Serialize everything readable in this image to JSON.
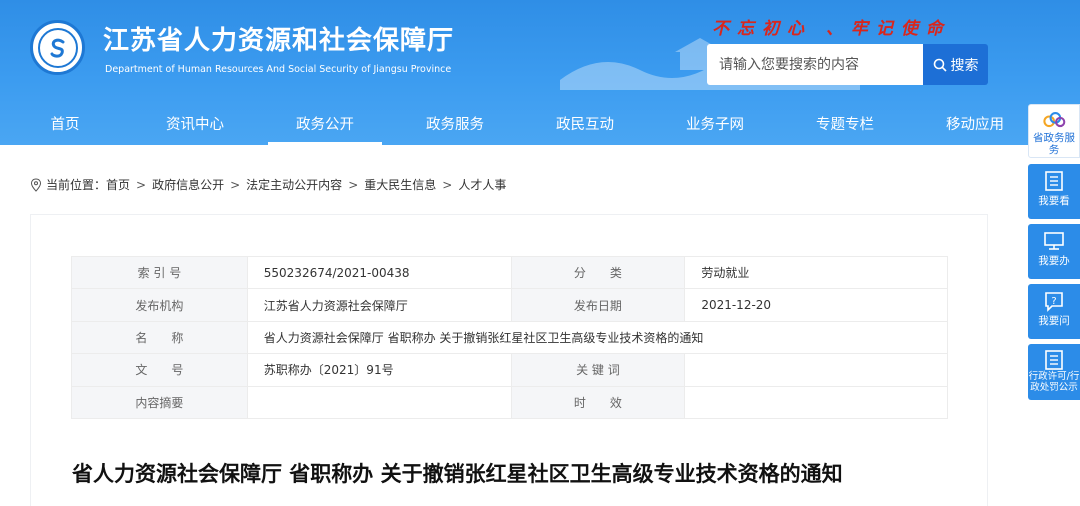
{
  "header": {
    "title": "江苏省人力资源和社会保障厅",
    "subtitle": "Department of Human Resources And Social Security of Jiangsu Province",
    "slogan": "不忘初心 、牢记使命",
    "search_placeholder": "请输入您要搜索的内容",
    "search_button": "搜索"
  },
  "nav": {
    "items": [
      "首页",
      "资讯中心",
      "政务公开",
      "政务服务",
      "政民互动",
      "业务子网",
      "专题专栏",
      "移动应用"
    ],
    "active": "政务公开"
  },
  "breadcrumb": {
    "prefix": "当前位置：",
    "items": [
      "首页",
      "政府信息公开",
      "法定主动公开内容",
      "重大民生信息",
      "人才人事"
    ]
  },
  "meta": {
    "rows": [
      {
        "l1": "索 引 号",
        "v1": "550232674/2021-00438",
        "l2": "分　　类",
        "v2": "劳动就业"
      },
      {
        "l1": "发布机构",
        "v1": "江苏省人力资源社会保障厅",
        "l2": "发布日期",
        "v2": "2021-12-20"
      },
      {
        "l1": "名　　称",
        "v1": "省人力资源社会保障厅 省职称办 关于撤销张红星社区卫生高级专业技术资格的通知"
      },
      {
        "l1": "文　　号",
        "v1": "苏职称办〔2021〕91号",
        "l2": "关 键 词",
        "v2": ""
      },
      {
        "l1": "内容摘要",
        "v1": "",
        "l2": "时　　效",
        "v2": ""
      }
    ]
  },
  "article": {
    "title": "省人力资源社会保障厅 省职称办 关于撤销张红星社区卫生高级专业技术资格的通知"
  },
  "sidebar": {
    "items": [
      {
        "label": "省政务服务",
        "icon": "cloud-logo-icon"
      },
      {
        "label": "我要看",
        "icon": "document-icon"
      },
      {
        "label": "我要办",
        "icon": "monitor-icon"
      },
      {
        "label": "我要问",
        "icon": "question-icon"
      },
      {
        "label": "行政许可/行政处罚公示",
        "icon": "list-icon"
      }
    ]
  },
  "colors": {
    "header_blue": "#3c9cf0",
    "search_button": "#1d6fd6",
    "slogan_red": "#d9261c",
    "sidebar_blue": "#2c8ce8"
  }
}
